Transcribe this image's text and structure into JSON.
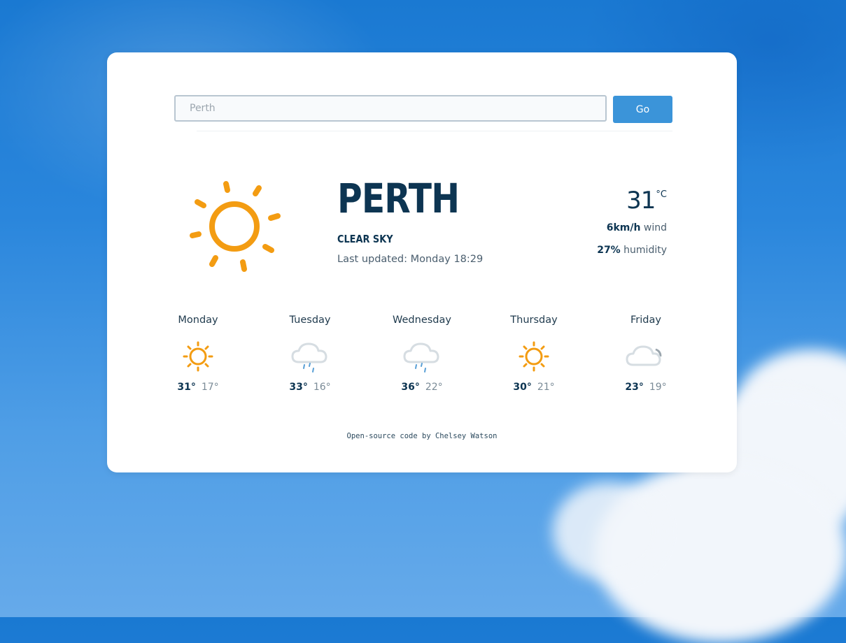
{
  "search": {
    "placeholder": "Perth",
    "value": "",
    "button_label": "Go"
  },
  "current": {
    "city": "PERTH",
    "condition": "CLEAR SKY",
    "updated": "Last updated: Monday 18:29",
    "icon": "sun-icon",
    "temperature": "31",
    "unit": "°C",
    "wind_value": "6km/h",
    "wind_label": "wind",
    "humidity_value": "27%",
    "humidity_label": "humidity"
  },
  "forecast": [
    {
      "day": "Monday",
      "icon": "sun-icon",
      "high": "31°",
      "low": "17°"
    },
    {
      "day": "Tuesday",
      "icon": "rain-cloud-icon",
      "high": "33°",
      "low": "16°"
    },
    {
      "day": "Wednesday",
      "icon": "rain-cloud-icon",
      "high": "36°",
      "low": "22°"
    },
    {
      "day": "Thursday",
      "icon": "sun-icon",
      "high": "30°",
      "low": "21°"
    },
    {
      "day": "Friday",
      "icon": "cloud-moon-icon",
      "high": "23°",
      "low": "19°"
    }
  ],
  "footer": {
    "credit": "Open-source code by Chelsey Watson"
  },
  "colors": {
    "accent": "#3b94d9",
    "sun": "#f39c12",
    "text_dark": "#0d3552",
    "rain": "#5aa0d6"
  }
}
